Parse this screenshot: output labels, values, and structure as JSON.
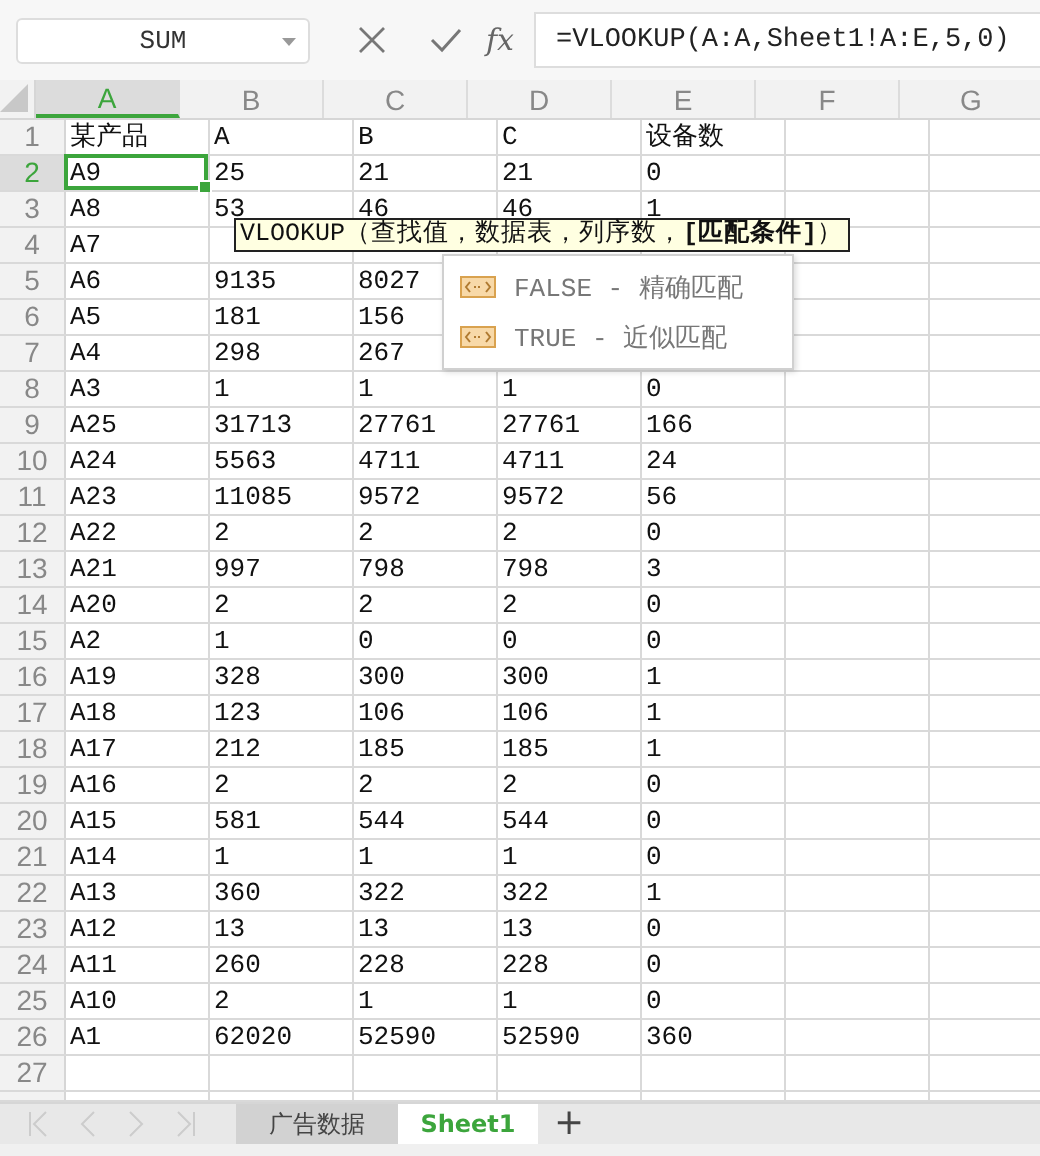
{
  "formula_bar": {
    "name_box": "SUM",
    "function_label": "fx",
    "formula": "=VLOOKUP(A:A,Sheet1!A:E,5,0)"
  },
  "columns": [
    {
      "label": "A",
      "selected": true
    },
    {
      "label": "B",
      "selected": false
    },
    {
      "label": "C",
      "selected": false
    },
    {
      "label": "D",
      "selected": false
    },
    {
      "label": "E",
      "selected": false
    },
    {
      "label": "F",
      "selected": false
    },
    {
      "label": "G",
      "selected": false
    }
  ],
  "rows": [
    {
      "number": "1",
      "selected": false,
      "cells": [
        "某产品",
        "A",
        "B",
        "C",
        "设备数"
      ]
    },
    {
      "number": "2",
      "selected": true,
      "cells": [
        "A9",
        "25",
        "21",
        "21",
        "0"
      ]
    },
    {
      "number": "3",
      "selected": false,
      "cells": [
        "A8",
        "53",
        "46",
        "46",
        "1"
      ]
    },
    {
      "number": "4",
      "selected": false,
      "cells": [
        "A7"
      ]
    },
    {
      "number": "5",
      "selected": false,
      "cells": [
        "A6",
        "9135",
        "8027"
      ]
    },
    {
      "number": "6",
      "selected": false,
      "cells": [
        "A5",
        "181",
        "156"
      ]
    },
    {
      "number": "7",
      "selected": false,
      "cells": [
        "A4",
        "298",
        "267"
      ]
    },
    {
      "number": "8",
      "selected": false,
      "cells": [
        "A3",
        "1",
        "1",
        "1",
        "0"
      ]
    },
    {
      "number": "9",
      "selected": false,
      "cells": [
        "A25",
        "31713",
        "27761",
        "27761",
        "166"
      ]
    },
    {
      "number": "10",
      "selected": false,
      "cells": [
        "A24",
        "5563",
        "4711",
        "4711",
        "24"
      ]
    },
    {
      "number": "11",
      "selected": false,
      "cells": [
        "A23",
        "11085",
        "9572",
        "9572",
        "56"
      ]
    },
    {
      "number": "12",
      "selected": false,
      "cells": [
        "A22",
        "2",
        "2",
        "2",
        "0"
      ]
    },
    {
      "number": "13",
      "selected": false,
      "cells": [
        "A21",
        "997",
        "798",
        "798",
        "3"
      ]
    },
    {
      "number": "14",
      "selected": false,
      "cells": [
        "A20",
        "2",
        "2",
        "2",
        "0"
      ]
    },
    {
      "number": "15",
      "selected": false,
      "cells": [
        "A2",
        "1",
        "0",
        "0",
        "0"
      ]
    },
    {
      "number": "16",
      "selected": false,
      "cells": [
        "A19",
        "328",
        "300",
        "300",
        "1"
      ]
    },
    {
      "number": "17",
      "selected": false,
      "cells": [
        "A18",
        "123",
        "106",
        "106",
        "1"
      ]
    },
    {
      "number": "18",
      "selected": false,
      "cells": [
        "A17",
        "212",
        "185",
        "185",
        "1"
      ]
    },
    {
      "number": "19",
      "selected": false,
      "cells": [
        "A16",
        "2",
        "2",
        "2",
        "0"
      ]
    },
    {
      "number": "20",
      "selected": false,
      "cells": [
        "A15",
        "581",
        "544",
        "544",
        "0"
      ]
    },
    {
      "number": "21",
      "selected": false,
      "cells": [
        "A14",
        "1",
        "1",
        "1",
        "0"
      ]
    },
    {
      "number": "22",
      "selected": false,
      "cells": [
        "A13",
        "360",
        "322",
        "322",
        "1"
      ]
    },
    {
      "number": "23",
      "selected": false,
      "cells": [
        "A12",
        "13",
        "13",
        "13",
        "0"
      ]
    },
    {
      "number": "24",
      "selected": false,
      "cells": [
        "A11",
        "260",
        "228",
        "228",
        "0"
      ]
    },
    {
      "number": "25",
      "selected": false,
      "cells": [
        "A10",
        "2",
        "1",
        "1",
        "0"
      ]
    },
    {
      "number": "26",
      "selected": false,
      "cells": [
        "A1",
        "62020",
        "52590",
        "52590",
        "360"
      ]
    },
    {
      "number": "27",
      "selected": false,
      "cells": []
    }
  ],
  "tooltip": "VLOOKUP（查找值，数据表，列序数，**[匹配条件]**）",
  "suggestions": [
    {
      "label": "FALSE - 精确匹配"
    },
    {
      "label": "TRUE - 近似匹配"
    }
  ],
  "sheet_tabs": [
    {
      "label": "广告数据",
      "selected": false
    },
    {
      "label": "Sheet1",
      "selected": true
    }
  ],
  "add_sheet": "+"
}
